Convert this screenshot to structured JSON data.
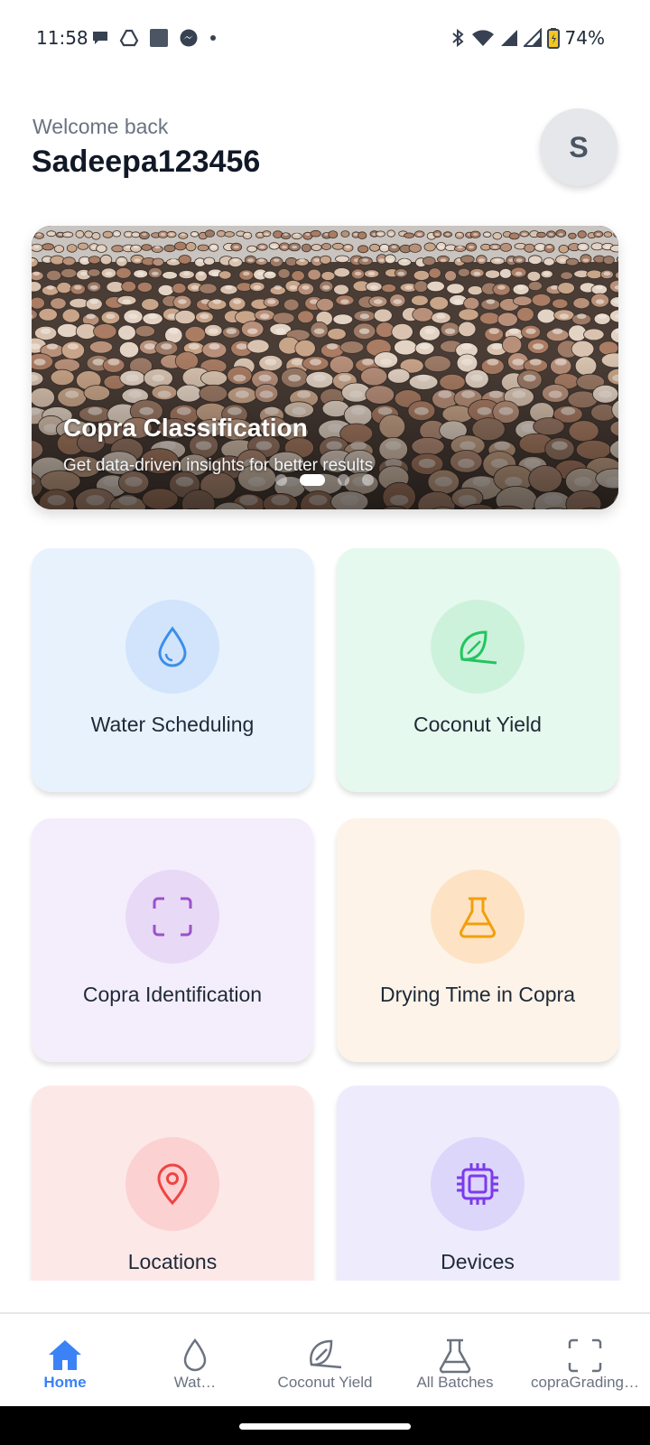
{
  "status_bar": {
    "time": "11:58",
    "battery": "74%",
    "left_icons": [
      "chat-icon",
      "drive-icon",
      "app-square-icon",
      "messenger-icon",
      "dot-icon"
    ],
    "right_icons": [
      "bluetooth-icon",
      "wifi-icon",
      "signal-icon",
      "signal-icon",
      "battery-icon"
    ]
  },
  "header": {
    "welcome": "Welcome back",
    "username": "Sadeepa123456",
    "avatar_initial": "S"
  },
  "banner": {
    "title": "Copra Classification",
    "subtitle": "Get data-driven insights for better results",
    "slide_count": 4,
    "active_slide": 2
  },
  "cards": [
    {
      "label": "Water Scheduling",
      "icon": "water-drop-icon",
      "bg": "#e8f2fd",
      "circle": "#d1e4fb",
      "icon_color": "#3b8eea"
    },
    {
      "label": "Coconut Yield",
      "icon": "leaf-icon",
      "bg": "#e6f9ee",
      "circle": "#cdf2dc",
      "icon_color": "#22c55e"
    },
    {
      "label": "Copra Identification",
      "icon": "scan-icon",
      "bg": "#f4eefc",
      "circle": "#e8d9f6",
      "icon_color": "#9b51c9"
    },
    {
      "label": "Drying Time in Copra",
      "icon": "flask-icon",
      "bg": "#fdf3e8",
      "circle": "#fde3c4",
      "icon_color": "#f59e0b"
    },
    {
      "label": "Locations",
      "icon": "map-pin-icon",
      "bg": "#fde8e8",
      "circle": "#fbd1d1",
      "icon_color": "#ef4444"
    },
    {
      "label": "Devices",
      "icon": "chip-icon",
      "bg": "#eeebfd",
      "circle": "#ddd6fb",
      "icon_color": "#7c3aed"
    }
  ],
  "nav": {
    "items": [
      {
        "label": "Home",
        "icon": "home-icon",
        "active": true
      },
      {
        "label": "Wat…",
        "icon": "water-drop-icon",
        "active": false
      },
      {
        "label": "Coconut Yield",
        "icon": "leaf-icon",
        "active": false
      },
      {
        "label": "All Batches",
        "icon": "flask-icon",
        "active": false
      },
      {
        "label": "copraGrading…",
        "icon": "scan-icon",
        "active": false
      }
    ],
    "active_color": "#3b82f6",
    "inactive_color": "#6b7280"
  }
}
